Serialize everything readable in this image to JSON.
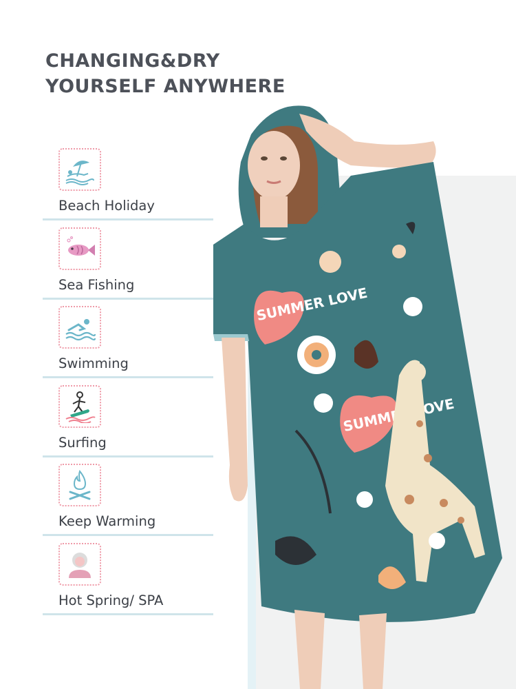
{
  "headline": {
    "line1": "CHANGING&DRY",
    "line2": "YOURSELF ANYWHERE"
  },
  "features": [
    {
      "label": "Beach Holiday",
      "icon": "beach-umbrella-icon"
    },
    {
      "label": "Sea Fishing",
      "icon": "fish-icon"
    },
    {
      "label": "Swimming",
      "icon": "swimmer-icon"
    },
    {
      "label": "Surfing",
      "icon": "surfer-icon"
    },
    {
      "label": "Keep Warming",
      "icon": "campfire-icon"
    },
    {
      "label": "Hot Spring/ SPA",
      "icon": "spa-person-icon"
    }
  ],
  "poncho_prints": [
    "SUMMER LOVE",
    "SUMMER LOVE"
  ],
  "colors": {
    "headline": "#4d5159",
    "icon_border": "#ef9aa8",
    "rule": "#cfe4ea",
    "poncho": "#3f7a80",
    "heart": "#f08a84"
  }
}
